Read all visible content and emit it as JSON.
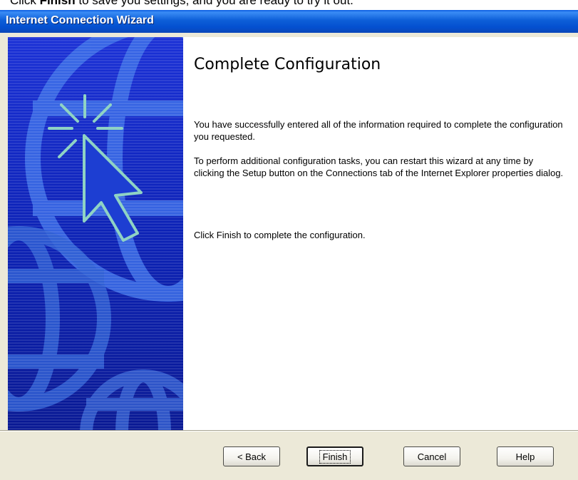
{
  "caption": {
    "prefix": "Click ",
    "bold": "Finish",
    "suffix": " to save you settings, and you are ready to try it out."
  },
  "window": {
    "title": "Internet Connection Wizard"
  },
  "sidebar": {
    "icons": [
      "globe-icon",
      "cursor-arrow-icon"
    ]
  },
  "content": {
    "heading": "Complete Configuration",
    "paragraphs": [
      "You have successfully entered all of the information required to complete the configuration you requested.",
      "To perform additional configuration tasks, you can restart this wizard at any time by clicking the Setup button on the Connections tab of the Internet Explorer properties dialog.",
      "Click Finish to complete the configuration."
    ]
  },
  "buttons": {
    "back": "< Back",
    "finish": "Finish",
    "cancel": "Cancel",
    "help": "Help"
  },
  "colors": {
    "titlebar": "#0450d0",
    "sidebar": "#0b21b6",
    "dialog_face": "#ece9d8"
  }
}
